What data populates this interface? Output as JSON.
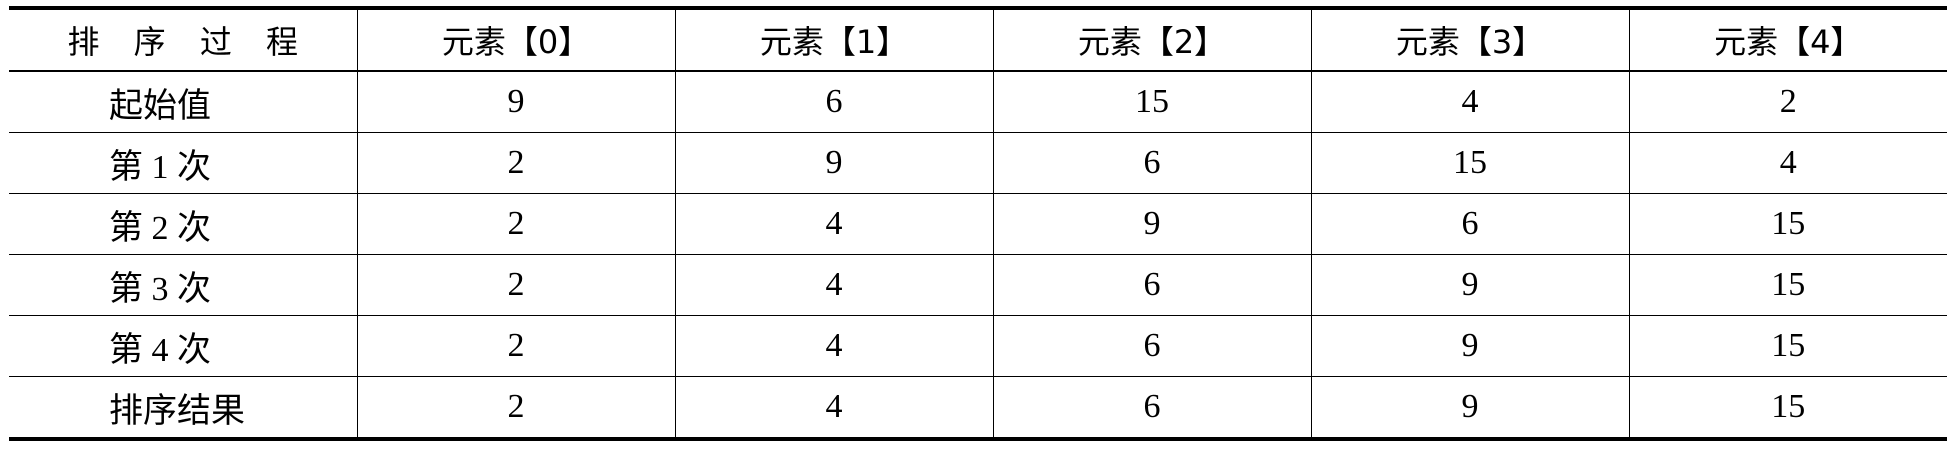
{
  "table": {
    "headers": [
      "排 序 过 程",
      "元素【0】",
      "元素【1】",
      "元素【2】",
      "元素【3】",
      "元素【4】"
    ],
    "rows": [
      {
        "label": "起始值",
        "values": [
          "9",
          "6",
          "15",
          "4",
          "2"
        ]
      },
      {
        "label": "第 1 次",
        "values": [
          "2",
          "9",
          "6",
          "15",
          "4"
        ]
      },
      {
        "label": "第 2 次",
        "values": [
          "2",
          "4",
          "9",
          "6",
          "15"
        ]
      },
      {
        "label": "第 3 次",
        "values": [
          "2",
          "4",
          "6",
          "9",
          "15"
        ]
      },
      {
        "label": "第 4 次",
        "values": [
          "2",
          "4",
          "6",
          "9",
          "15"
        ]
      },
      {
        "label": "排序结果",
        "values": [
          "2",
          "4",
          "6",
          "9",
          "15"
        ]
      }
    ]
  }
}
